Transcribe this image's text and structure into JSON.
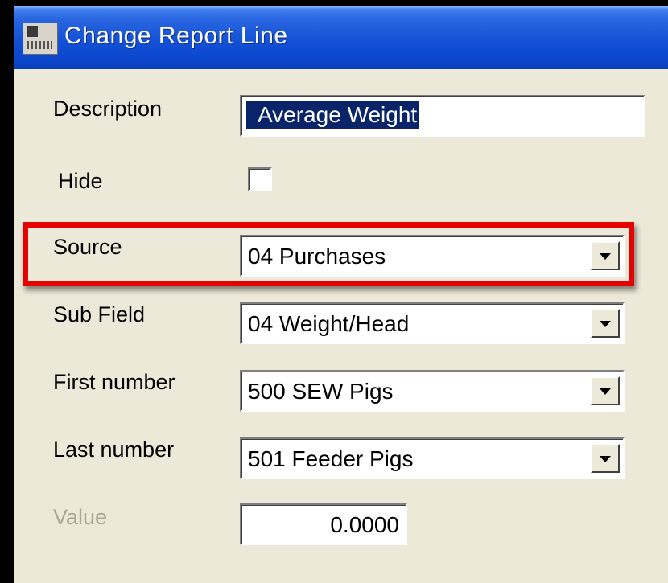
{
  "window": {
    "title": "Change Report Line",
    "icon": "report-app-icon"
  },
  "form": {
    "description": {
      "label": "Description",
      "value": "Average Weight"
    },
    "hide": {
      "label": "Hide",
      "checked": false
    },
    "source": {
      "label": "Source",
      "value": "04  Purchases"
    },
    "sub_field": {
      "label": "Sub Field",
      "value": "04  Weight/Head"
    },
    "first_number": {
      "label": "First number",
      "value": "500  SEW Pigs"
    },
    "last_number": {
      "label": "Last number",
      "value": "501  Feeder Pigs"
    },
    "value": {
      "label": "Value",
      "value": "0.0000"
    }
  },
  "colors": {
    "highlight": "#e60000",
    "titlebar": "#1451d6",
    "selection": "#0a246a",
    "dialog_bg": "#ece9d8"
  }
}
